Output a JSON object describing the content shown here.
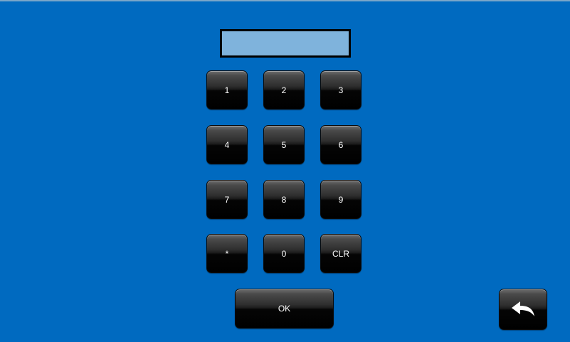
{
  "display": {
    "value": ""
  },
  "keypad": {
    "keys": [
      "1",
      "2",
      "3",
      "4",
      "5",
      "6",
      "7",
      "8",
      "9",
      "*",
      "0",
      "CLR"
    ],
    "ok_label": "OK"
  },
  "colors": {
    "background": "#006ac0",
    "display_fill": "#7fb3dc",
    "key_face": "#000000",
    "key_text": "#ffffff"
  },
  "icons": {
    "back": "back-arrow-icon"
  }
}
